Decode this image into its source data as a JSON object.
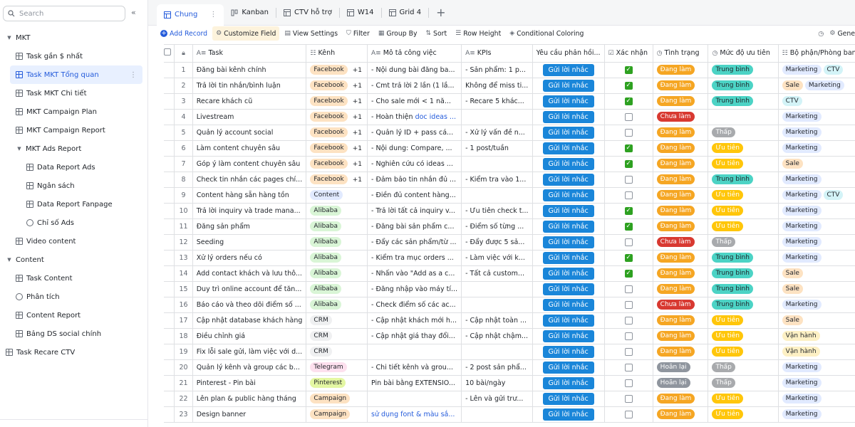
{
  "sidebar": {
    "search_placeholder": "Search",
    "items": [
      {
        "label": "MKT",
        "level": 0,
        "kind": "group"
      },
      {
        "label": "Task gần $ nhất",
        "level": 1,
        "kind": "grid"
      },
      {
        "label": "Task MKT Tổng quan",
        "level": 1,
        "kind": "grid",
        "active": true
      },
      {
        "label": "Task MKT Chi tiết",
        "level": 1,
        "kind": "grid"
      },
      {
        "label": "MKT Campaign Plan",
        "level": 1,
        "kind": "grid"
      },
      {
        "label": "MKT Campaign Report",
        "level": 1,
        "kind": "grid"
      },
      {
        "label": "MKT Ads Report",
        "level": 1,
        "kind": "group"
      },
      {
        "label": "Data Report Ads",
        "level": 2,
        "kind": "grid"
      },
      {
        "label": "Ngân sách",
        "level": 2,
        "kind": "grid"
      },
      {
        "label": "Data Report Fanpage",
        "level": 2,
        "kind": "grid"
      },
      {
        "label": "Chỉ số Ads",
        "level": 2,
        "kind": "gauge"
      },
      {
        "label": "Video content",
        "level": 1,
        "kind": "grid"
      },
      {
        "label": "Content",
        "level": 0,
        "kind": "group"
      },
      {
        "label": "Task Content",
        "level": 1,
        "kind": "grid"
      },
      {
        "label": "Phân tích",
        "level": 1,
        "kind": "gauge"
      },
      {
        "label": "Content Report",
        "level": 1,
        "kind": "grid"
      },
      {
        "label": "Bảng DS social chính",
        "level": 1,
        "kind": "grid"
      },
      {
        "label": "Task Recare CTV",
        "level": 0,
        "kind": "grid"
      }
    ]
  },
  "tabs": [
    {
      "label": "Chung",
      "active": true
    },
    {
      "label": "Kanban"
    },
    {
      "label": "CTV hỗ trợ"
    },
    {
      "label": "W14"
    },
    {
      "label": "Grid 4"
    }
  ],
  "toolbar": {
    "add_record": "Add Record",
    "customize_field": "Customize Field",
    "view_settings": "View Settings",
    "filter": "Filter",
    "group_by": "Group By",
    "sort": "Sort",
    "row_height": "Row Height",
    "conditional_coloring": "Conditional Coloring",
    "right_label": "Gene"
  },
  "colors": {
    "accent": "#245bdb",
    "remind_button": "#1a86d9",
    "check_green": "#2ea121",
    "status_doing": "#ffc60a",
    "status_todo": "#d83931",
    "status_postponed": "#8f959e"
  },
  "columns": [
    "Task",
    "Kênh",
    "Mô tả công việc",
    "KPIs",
    "Yêu cầu phản hồi...",
    "Xác nhận",
    "Tình trạng",
    "Mức độ ưu tiên",
    "Bộ phận/Phòng ban"
  ],
  "remind_label": "Gửi lời nhắc",
  "rows": [
    {
      "no": "1",
      "task": "Đăng bài kênh chính",
      "kenh": "Facebook",
      "plus": "+1",
      "mota": "- Nội dung bài đăng ba...",
      "kpi": "- Sản phẩm: 1 p...",
      "xn": true,
      "tt": "Đang làm",
      "mdut": "Trung bình",
      "bp": [
        "Marketing",
        "CTV"
      ]
    },
    {
      "no": "2",
      "task": "Trả lời tin nhắn/bình luận",
      "kenh": "Facebook",
      "plus": "+1",
      "mota": "- Cmt trả lời 2 lần (1 lầ...",
      "kpi": "Không để miss ti...",
      "xn": true,
      "tt": "Đang làm",
      "mdut": "Trung bình",
      "bp": [
        "Sale",
        "Marketing"
      ]
    },
    {
      "no": "3",
      "task": "Recare khách cũ",
      "kenh": "Facebook",
      "plus": "+1",
      "mota": "- Cho sale mới < 1 nă...",
      "kpi": "- Recare 5 khác...",
      "xn": true,
      "tt": "Đang làm",
      "mdut": "Trung bình",
      "bp": [
        "CTV"
      ]
    },
    {
      "no": "4",
      "task": "Livestream",
      "kenh": "Facebook",
      "plus": "+1",
      "mota": "- Hoàn thiện ",
      "mota_link": "doc ideas ...",
      "kpi": "",
      "xn": false,
      "tt": "Chưa làm",
      "mdut": "",
      "bp": [
        "Marketing"
      ]
    },
    {
      "no": "5",
      "task": "Quản lý account social",
      "kenh": "Facebook",
      "plus": "+1",
      "mota": "- Quản lý ID + pass cá...",
      "kpi": "- Xử lý vấn đề n...",
      "xn": false,
      "tt": "Đang làm",
      "mdut": "Thấp",
      "bp": [
        "Marketing"
      ]
    },
    {
      "no": "6",
      "task": "Làm content chuyên sâu",
      "kenh": "Facebook",
      "plus": "+1",
      "mota": "- Nội dung: Compare, ...",
      "kpi": "- 1 post/tuần",
      "xn": true,
      "tt": "Đang làm",
      "mdut": "Ưu tiên",
      "bp": [
        "Marketing"
      ]
    },
    {
      "no": "7",
      "task": "Góp ý làm content chuyên sâu",
      "kenh": "Facebook",
      "plus": "+1",
      "mota": "- Nghiên cứu có ideas ...",
      "kpi": "",
      "xn": true,
      "tt": "Đang làm",
      "mdut": "Ưu tiên",
      "bp": [
        "Sale"
      ]
    },
    {
      "no": "8",
      "task": "Check tin nhắn các pages chí...",
      "kenh": "Facebook",
      "plus": "+1",
      "mota": "- Đảm bảo tin nhắn đủ ...",
      "kpi": "- Kiểm tra vào 1...",
      "xn": false,
      "tt": "Đang làm",
      "mdut": "Trung bình",
      "bp": [
        "Marketing"
      ]
    },
    {
      "no": "9",
      "task": "Content hàng sẵn hàng tồn",
      "kenh": "Content",
      "plus": "",
      "mota": "- Điền đủ content hàng...",
      "kpi": "",
      "xn": false,
      "tt": "Đang làm",
      "mdut": "Ưu tiên",
      "bp": [
        "Marketing",
        "CTV"
      ]
    },
    {
      "no": "10",
      "task": "Trả lời inquiry và trade mana...",
      "kenh": "Alibaba",
      "plus": "",
      "mota": "- Trả lời tất cả inquiry v...",
      "kpi": "- Ưu tiên check t...",
      "xn": true,
      "tt": "Đang làm",
      "mdut": "Ưu tiên",
      "bp": [
        "Marketing"
      ]
    },
    {
      "no": "11",
      "task": "Đăng sản phẩm",
      "kenh": "Alibaba",
      "plus": "",
      "mota": "- Đăng bài sản phẩm c...",
      "kpi": "- Điểm số từng ...",
      "xn": true,
      "tt": "Đang làm",
      "mdut": "Ưu tiên",
      "bp": [
        "Marketing"
      ]
    },
    {
      "no": "12",
      "task": "Seeding",
      "kenh": "Alibaba",
      "plus": "",
      "mota": "- Đẩy các sản phẩm/từ ...",
      "kpi": "- Đẩy được 5 sả...",
      "xn": false,
      "tt": "Chưa làm",
      "mdut": "Thấp",
      "bp": [
        "Marketing"
      ]
    },
    {
      "no": "13",
      "task": "Xử lý orders nếu có",
      "kenh": "Alibaba",
      "plus": "",
      "mota": "- Kiểm tra mục orders ...",
      "kpi": "- Làm việc với k...",
      "xn": true,
      "tt": "Đang làm",
      "mdut": "Trung bình",
      "bp": [
        "Marketing"
      ]
    },
    {
      "no": "14",
      "task": "Add contact khách và lưu thô...",
      "kenh": "Alibaba",
      "plus": "",
      "mota": "- Nhấn vào \"Add as a c...",
      "kpi": "- Tất cả custom...",
      "xn": true,
      "tt": "Đang làm",
      "mdut": "Trung bình",
      "bp": [
        "Sale"
      ]
    },
    {
      "no": "15",
      "task": "Duy trì online account để tăn...",
      "kenh": "Alibaba",
      "plus": "",
      "mota": "- Đăng nhập vào máy tí...",
      "kpi": "",
      "xn": false,
      "tt": "Đang làm",
      "mdut": "Trung bình",
      "bp": [
        "Sale"
      ]
    },
    {
      "no": "16",
      "task": "Báo cáo và theo dõi điểm số ...",
      "kenh": "Alibaba",
      "plus": "",
      "mota": "- Check điểm số các ac...",
      "kpi": "",
      "xn": false,
      "tt": "Chưa làm",
      "mdut": "Trung bình",
      "bp": [
        "Marketing"
      ]
    },
    {
      "no": "17",
      "task": "Cập nhật database khách hàng",
      "kenh": "CRM",
      "plus": "",
      "mota": "- Cập nhật khách mới h...",
      "kpi": "- Cập nhật toàn ...",
      "xn": false,
      "tt": "Đang làm",
      "mdut": "Ưu tiên",
      "bp": [
        "Sale"
      ]
    },
    {
      "no": "18",
      "task": "Điều chỉnh giá",
      "kenh": "CRM",
      "plus": "",
      "mota": "- Cập nhật giá thay đổi...",
      "kpi": "- Cập nhật chậm...",
      "xn": false,
      "tt": "Đang làm",
      "mdut": "Ưu tiên",
      "bp": [
        "Vận hành"
      ]
    },
    {
      "no": "19",
      "task": "Fix lỗi sale gửi, làm việc với d...",
      "kenh": "CRM",
      "plus": "",
      "mota": "",
      "kpi": "",
      "xn": false,
      "tt": "Đang làm",
      "mdut": "Ưu tiên",
      "bp": [
        "Vận hành"
      ]
    },
    {
      "no": "20",
      "task": "Quản lý kênh và group các b...",
      "kenh": "Telegram",
      "plus": "",
      "mota": "- Chi tiết kênh và grou...",
      "kpi": "- 2 post sản phẩ...",
      "xn": false,
      "tt": "Hoãn lại",
      "mdut": "Thấp",
      "bp": [
        "Marketing"
      ]
    },
    {
      "no": "21",
      "task": "Pinterest - Pin bài",
      "kenh": "Pinterest",
      "plus": "",
      "mota": "Pin bài bằng EXTENSIO...",
      "kpi": "10 bài/ngày",
      "xn": false,
      "tt": "Hoãn lại",
      "mdut": "Thấp",
      "bp": [
        "Marketing"
      ]
    },
    {
      "no": "22",
      "task": "Lên plan & public hàng tháng",
      "kenh": "Campaign",
      "plus": "",
      "mota": "- Lên và gửi trư...",
      "mota_in_kpi": true,
      "kpi": "- Lên và gửi trư...",
      "xn": false,
      "tt": "Đang làm",
      "mdut": "Ưu tiên",
      "bp": [
        "Marketing"
      ]
    },
    {
      "no": "23",
      "task": "Design banner",
      "kenh": "Campaign",
      "plus": "",
      "mota": "",
      "mota_link": "sử dụng font & màu sắ...",
      "kpi": "",
      "xn": false,
      "tt": "Đang làm",
      "mdut": "Ưu tiên",
      "bp": [
        "Marketing"
      ]
    }
  ]
}
